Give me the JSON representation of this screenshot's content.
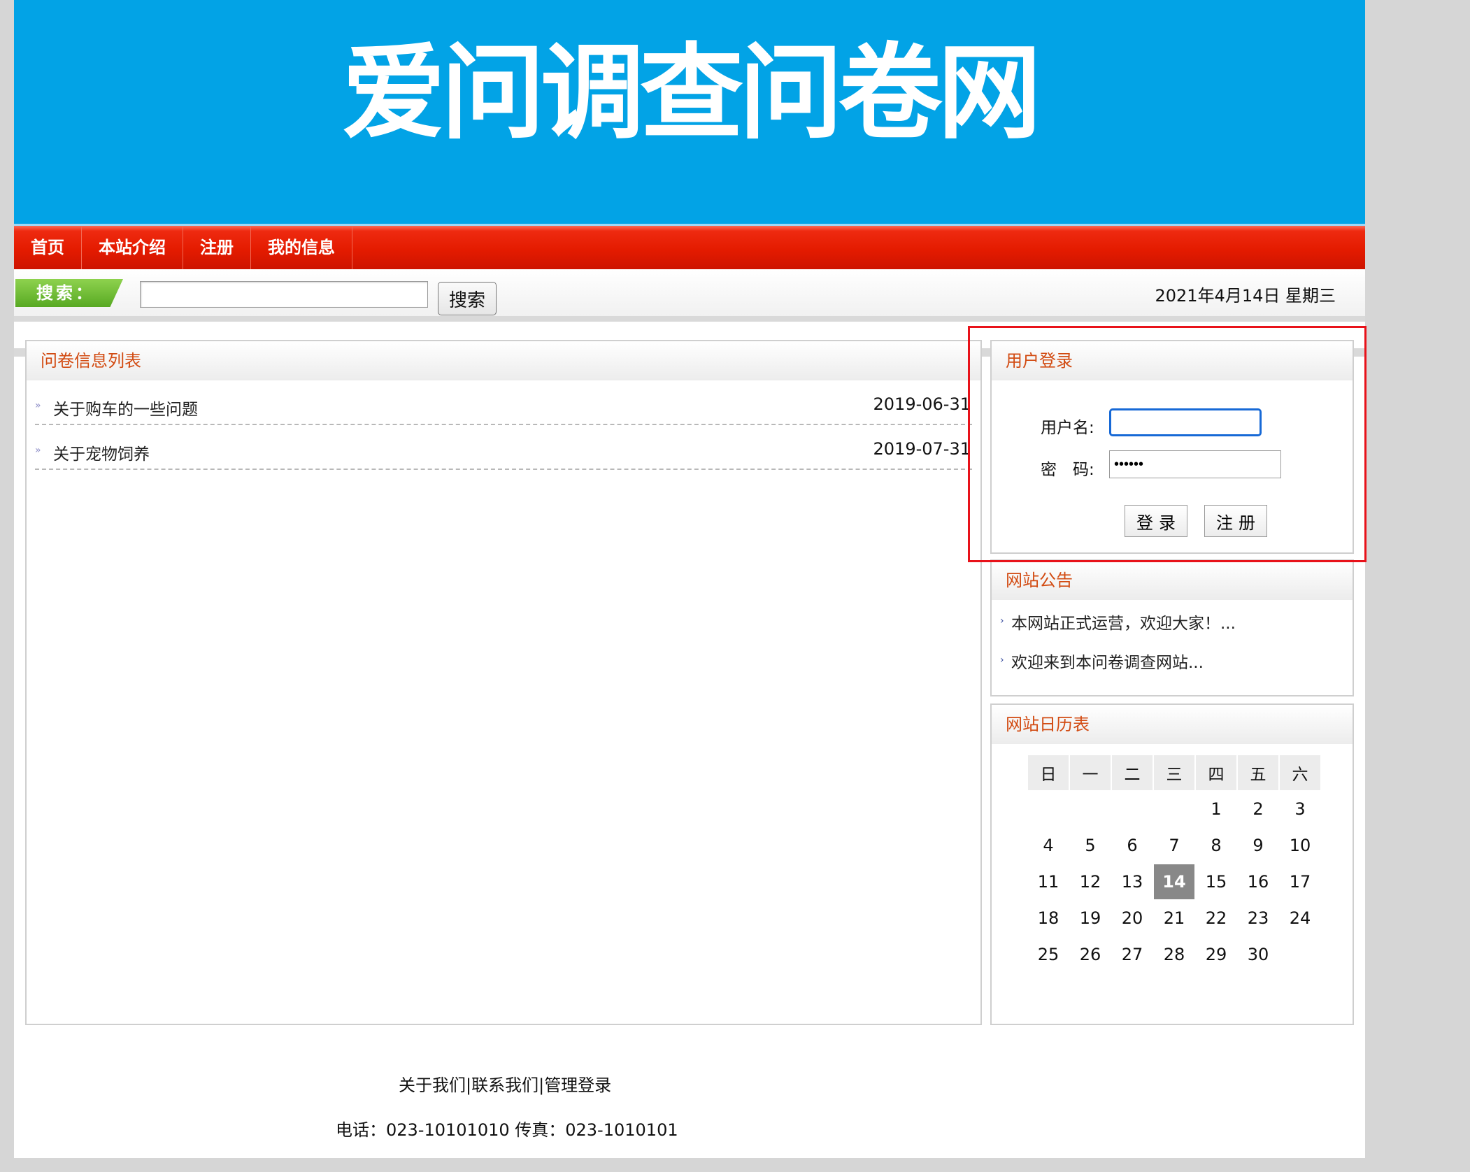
{
  "banner": {
    "title": "爱问调查问卷网"
  },
  "nav": {
    "items": [
      "首页",
      "本站介绍",
      "注册",
      "我的信息"
    ]
  },
  "search": {
    "tag": "搜索：",
    "button": "搜索",
    "value": ""
  },
  "date": "2021年4月14日 星期三",
  "survey_list": {
    "title": "问卷信息列表",
    "items": [
      {
        "title": "关于购车的一些问题",
        "date": "2019-06-31"
      },
      {
        "title": "关于宠物饲养",
        "date": "2019-07-31"
      }
    ]
  },
  "login": {
    "title": "用户登录",
    "username_label": "用户名:",
    "password_label": "密　码:",
    "username_value": "",
    "password_value": "••••••",
    "login_button": "登录",
    "register_button": "注册"
  },
  "notice": {
    "title": "网站公告",
    "items": [
      "本网站正式运营，欢迎大家！...",
      "欢迎来到本问卷调查网站..."
    ]
  },
  "calendar": {
    "title": "网站日历表",
    "weekdays": [
      "日",
      "一",
      "二",
      "三",
      "四",
      "五",
      "六"
    ],
    "weeks": [
      [
        "",
        "",
        "",
        "",
        "1",
        "2",
        "3"
      ],
      [
        "4",
        "5",
        "6",
        "7",
        "8",
        "9",
        "10"
      ],
      [
        "11",
        "12",
        "13",
        "14",
        "15",
        "16",
        "17"
      ],
      [
        "18",
        "19",
        "20",
        "21",
        "22",
        "23",
        "24"
      ],
      [
        "25",
        "26",
        "27",
        "28",
        "29",
        "30",
        ""
      ]
    ],
    "today": "14"
  },
  "footer": {
    "links": [
      "关于我们",
      "联系我们",
      "管理登录"
    ],
    "separator": "|",
    "contact": "电话：023-10101010 传真：023-1010101"
  },
  "colors": {
    "banner": "#02a3e6",
    "nav": "#e41b00",
    "panel_title": "#d24b12",
    "highlight": "#e8121a",
    "today": "#888888"
  }
}
